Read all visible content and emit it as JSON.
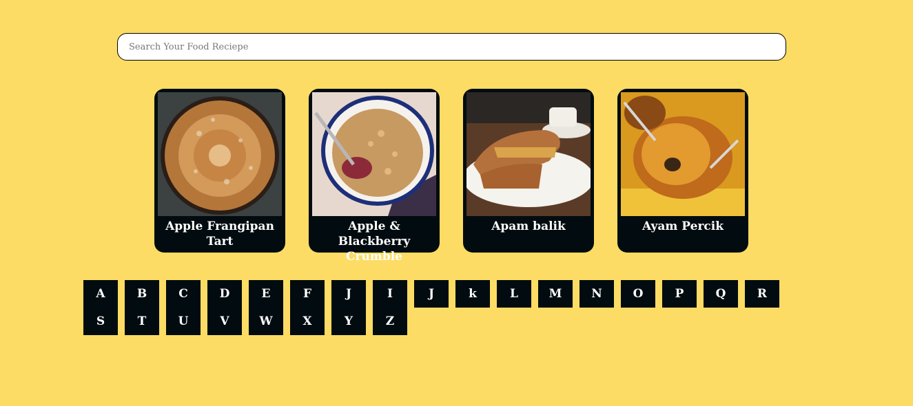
{
  "search": {
    "placeholder": "Search Your Food Reciepe",
    "value": ""
  },
  "recipes": [
    {
      "title": "Apple Frangipan Tart"
    },
    {
      "title": "Apple & Blackberry Crumble"
    },
    {
      "title": "Apam balik"
    },
    {
      "title": "Ayam Percik"
    }
  ],
  "letters": [
    "A",
    "B",
    "C",
    "D",
    "E",
    "F",
    "J",
    "I",
    "J",
    "k",
    "L",
    "M",
    "N",
    "O",
    "P",
    "Q",
    "R",
    "S",
    "T",
    "U",
    "V",
    "W",
    "X",
    "Y",
    "Z"
  ],
  "colors": {
    "background": "#fcdc64",
    "card": "#020c10",
    "text_light": "#ffffff"
  }
}
